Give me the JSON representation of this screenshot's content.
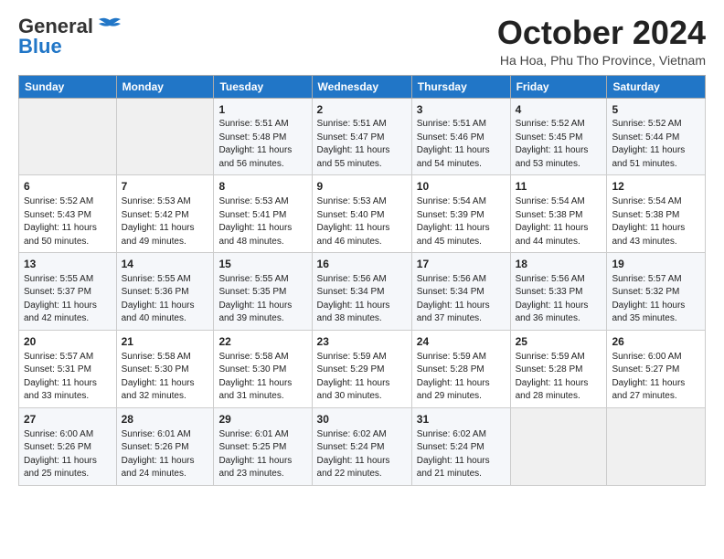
{
  "logo": {
    "general": "General",
    "blue": "Blue"
  },
  "header": {
    "month": "October 2024",
    "location": "Ha Hoa, Phu Tho Province, Vietnam"
  },
  "weekdays": [
    "Sunday",
    "Monday",
    "Tuesday",
    "Wednesday",
    "Thursday",
    "Friday",
    "Saturday"
  ],
  "weeks": [
    [
      {
        "day": "",
        "empty": true
      },
      {
        "day": "",
        "empty": true
      },
      {
        "day": "1",
        "sunrise": "5:51 AM",
        "sunset": "5:48 PM",
        "daylight": "11 hours and 56 minutes."
      },
      {
        "day": "2",
        "sunrise": "5:51 AM",
        "sunset": "5:47 PM",
        "daylight": "11 hours and 55 minutes."
      },
      {
        "day": "3",
        "sunrise": "5:51 AM",
        "sunset": "5:46 PM",
        "daylight": "11 hours and 54 minutes."
      },
      {
        "day": "4",
        "sunrise": "5:52 AM",
        "sunset": "5:45 PM",
        "daylight": "11 hours and 53 minutes."
      },
      {
        "day": "5",
        "sunrise": "5:52 AM",
        "sunset": "5:44 PM",
        "daylight": "11 hours and 51 minutes."
      }
    ],
    [
      {
        "day": "6",
        "sunrise": "5:52 AM",
        "sunset": "5:43 PM",
        "daylight": "11 hours and 50 minutes."
      },
      {
        "day": "7",
        "sunrise": "5:53 AM",
        "sunset": "5:42 PM",
        "daylight": "11 hours and 49 minutes."
      },
      {
        "day": "8",
        "sunrise": "5:53 AM",
        "sunset": "5:41 PM",
        "daylight": "11 hours and 48 minutes."
      },
      {
        "day": "9",
        "sunrise": "5:53 AM",
        "sunset": "5:40 PM",
        "daylight": "11 hours and 46 minutes."
      },
      {
        "day": "10",
        "sunrise": "5:54 AM",
        "sunset": "5:39 PM",
        "daylight": "11 hours and 45 minutes."
      },
      {
        "day": "11",
        "sunrise": "5:54 AM",
        "sunset": "5:38 PM",
        "daylight": "11 hours and 44 minutes."
      },
      {
        "day": "12",
        "sunrise": "5:54 AM",
        "sunset": "5:38 PM",
        "daylight": "11 hours and 43 minutes."
      }
    ],
    [
      {
        "day": "13",
        "sunrise": "5:55 AM",
        "sunset": "5:37 PM",
        "daylight": "11 hours and 42 minutes."
      },
      {
        "day": "14",
        "sunrise": "5:55 AM",
        "sunset": "5:36 PM",
        "daylight": "11 hours and 40 minutes."
      },
      {
        "day": "15",
        "sunrise": "5:55 AM",
        "sunset": "5:35 PM",
        "daylight": "11 hours and 39 minutes."
      },
      {
        "day": "16",
        "sunrise": "5:56 AM",
        "sunset": "5:34 PM",
        "daylight": "11 hours and 38 minutes."
      },
      {
        "day": "17",
        "sunrise": "5:56 AM",
        "sunset": "5:34 PM",
        "daylight": "11 hours and 37 minutes."
      },
      {
        "day": "18",
        "sunrise": "5:56 AM",
        "sunset": "5:33 PM",
        "daylight": "11 hours and 36 minutes."
      },
      {
        "day": "19",
        "sunrise": "5:57 AM",
        "sunset": "5:32 PM",
        "daylight": "11 hours and 35 minutes."
      }
    ],
    [
      {
        "day": "20",
        "sunrise": "5:57 AM",
        "sunset": "5:31 PM",
        "daylight": "11 hours and 33 minutes."
      },
      {
        "day": "21",
        "sunrise": "5:58 AM",
        "sunset": "5:30 PM",
        "daylight": "11 hours and 32 minutes."
      },
      {
        "day": "22",
        "sunrise": "5:58 AM",
        "sunset": "5:30 PM",
        "daylight": "11 hours and 31 minutes."
      },
      {
        "day": "23",
        "sunrise": "5:59 AM",
        "sunset": "5:29 PM",
        "daylight": "11 hours and 30 minutes."
      },
      {
        "day": "24",
        "sunrise": "5:59 AM",
        "sunset": "5:28 PM",
        "daylight": "11 hours and 29 minutes."
      },
      {
        "day": "25",
        "sunrise": "5:59 AM",
        "sunset": "5:28 PM",
        "daylight": "11 hours and 28 minutes."
      },
      {
        "day": "26",
        "sunrise": "6:00 AM",
        "sunset": "5:27 PM",
        "daylight": "11 hours and 27 minutes."
      }
    ],
    [
      {
        "day": "27",
        "sunrise": "6:00 AM",
        "sunset": "5:26 PM",
        "daylight": "11 hours and 25 minutes."
      },
      {
        "day": "28",
        "sunrise": "6:01 AM",
        "sunset": "5:26 PM",
        "daylight": "11 hours and 24 minutes."
      },
      {
        "day": "29",
        "sunrise": "6:01 AM",
        "sunset": "5:25 PM",
        "daylight": "11 hours and 23 minutes."
      },
      {
        "day": "30",
        "sunrise": "6:02 AM",
        "sunset": "5:24 PM",
        "daylight": "11 hours and 22 minutes."
      },
      {
        "day": "31",
        "sunrise": "6:02 AM",
        "sunset": "5:24 PM",
        "daylight": "11 hours and 21 minutes."
      },
      {
        "day": "",
        "empty": true
      },
      {
        "day": "",
        "empty": true
      }
    ]
  ]
}
